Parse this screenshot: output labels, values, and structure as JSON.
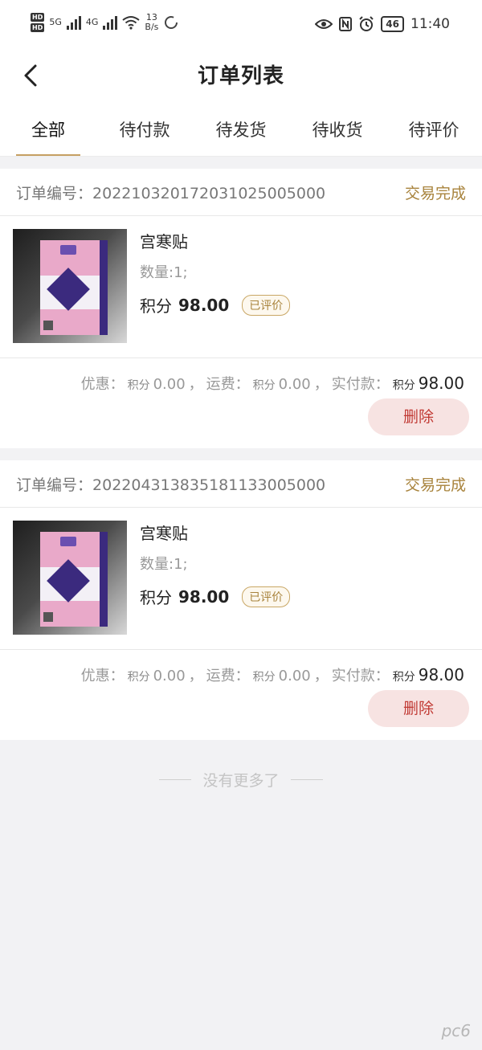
{
  "status_bar": {
    "hd_top": "HD",
    "hd_bottom": "HD",
    "net_type": "5G",
    "net_type2": "4G",
    "speed_value": "13",
    "speed_unit": "B/s",
    "battery": "46",
    "time": "11:40"
  },
  "header": {
    "title": "订单列表"
  },
  "tabs": [
    {
      "label": "全部"
    },
    {
      "label": "待付款"
    },
    {
      "label": "待发货"
    },
    {
      "label": "待收货"
    },
    {
      "label": "待评价"
    }
  ],
  "orders": [
    {
      "order_label": "订单编号：",
      "order_no": "20221032017203102 5005000",
      "status": "交易完成",
      "item": {
        "name": "宫寒贴",
        "qty": "数量:1;",
        "price_unit": "积分",
        "price": "98.00",
        "badge": "已评价"
      },
      "summary": {
        "discount_label": "优惠：",
        "discount_unit": "积分",
        "discount": "0.00",
        "sep1": "，",
        "shipping_label": "运费：",
        "shipping_unit": "积分",
        "shipping": "0.00",
        "sep2": "，",
        "paid_label": "实付款：",
        "paid_unit": "积分",
        "paid": "98.00"
      },
      "delete_label": "删除"
    },
    {
      "order_label": "订单编号：",
      "order_no": "20220431383518113300 5000",
      "status": "交易完成",
      "item": {
        "name": "宫寒贴",
        "qty": "数量:1;",
        "price_unit": "积分",
        "price": "98.00",
        "badge": "已评价"
      },
      "summary": {
        "discount_label": "优惠：",
        "discount_unit": "积分",
        "discount": "0.00",
        "sep1": "，",
        "shipping_label": "运费：",
        "shipping_unit": "积分",
        "shipping": "0.00",
        "sep2": "，",
        "paid_label": "实付款：",
        "paid_unit": "积分",
        "paid": "98.00"
      },
      "delete_label": "删除"
    }
  ],
  "footer": {
    "no_more": "没有更多了"
  },
  "watermark": "pc6"
}
